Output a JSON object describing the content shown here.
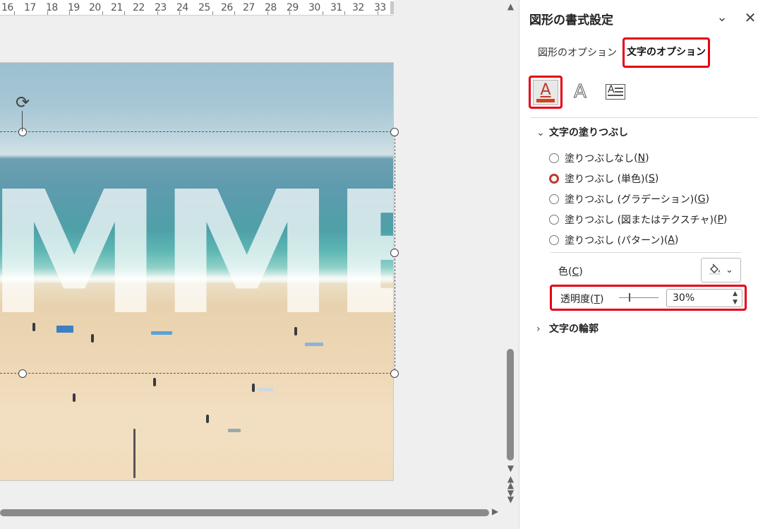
{
  "ruler": {
    "labels": [
      "16",
      "17",
      "18",
      "19",
      "20",
      "21",
      "22",
      "23",
      "24",
      "25",
      "26",
      "27",
      "28",
      "29",
      "30",
      "31",
      "32",
      "33"
    ]
  },
  "slide": {
    "text": "MMER"
  },
  "pane": {
    "title": "図形の書式設定",
    "tabs": {
      "shape_options": "図形のオプション",
      "text_options": "文字のオプション"
    },
    "icons": {
      "text_fill_letter": "A",
      "text_effects_letter": "A",
      "textbox_letter": "A"
    },
    "fill_section": {
      "title": "文字の塗りつぶし",
      "options": [
        {
          "label": "塗りつぶしなし",
          "key": "N",
          "selected": false
        },
        {
          "label": "塗りつぶし (単色)",
          "key": "S",
          "selected": true
        },
        {
          "label": "塗りつぶし (グラデーション)",
          "key": "G",
          "selected": false
        },
        {
          "label": "塗りつぶし (図またはテクスチャ)",
          "key": "P",
          "selected": false
        },
        {
          "label": "塗りつぶし (パターン)",
          "key": "A",
          "selected": false
        }
      ],
      "color_label": "色",
      "color_key": "C",
      "transparency_label": "透明度",
      "transparency_key": "T",
      "transparency_value": "30%"
    },
    "outline_section": {
      "title": "文字の輪郭"
    }
  },
  "colors": {
    "highlight": "#e60012",
    "accent": "#c0392b"
  }
}
